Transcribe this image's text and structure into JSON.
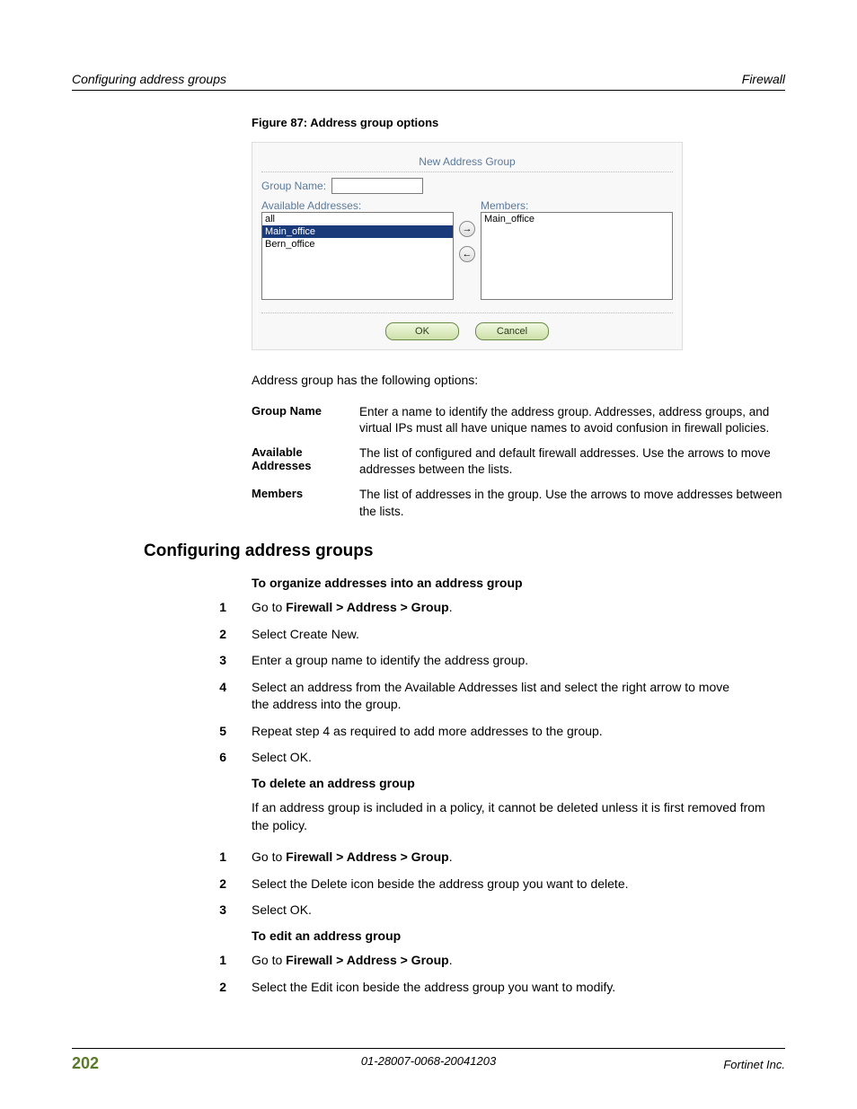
{
  "header": {
    "left": "Configuring address groups",
    "right": "Firewall"
  },
  "figure": {
    "caption": "Figure 87: Address group options",
    "title": "New Address Group",
    "group_name_label": "Group Name:",
    "available_label": "Available Addresses:",
    "members_label": "Members:",
    "available_items": [
      "all",
      "Main_office",
      "Bern_office"
    ],
    "available_selected_index": 1,
    "members_items": [
      "Main_office"
    ],
    "ok_label": "OK",
    "cancel_label": "Cancel"
  },
  "intro": "Address group has the following options:",
  "options": [
    {
      "term": "Group Name",
      "desc": "Enter a name to identify the address group. Addresses, address groups, and virtual IPs must all have unique names to avoid confusion in firewall policies."
    },
    {
      "term": "Available Addresses",
      "desc": "The list of configured and default firewall addresses. Use the arrows to move addresses between the lists."
    },
    {
      "term": "Members",
      "desc": "The list of addresses in the group. Use the arrows to move addresses between the lists."
    }
  ],
  "section_heading": "Configuring address groups",
  "proc1": {
    "heading": "To organize addresses into an address group",
    "steps": [
      {
        "n": "1",
        "pre": "Go to ",
        "bold": "Firewall > Address > Group",
        "post": "."
      },
      {
        "n": "2",
        "text": "Select Create New."
      },
      {
        "n": "3",
        "text": "Enter a group name to identify the address group."
      },
      {
        "n": "4",
        "text": "Select an address from the Available Addresses list and select the right arrow to move the address into the group."
      },
      {
        "n": "5",
        "text": "Repeat step 4 as required to add more addresses to the group."
      },
      {
        "n": "6",
        "text": "Select OK."
      }
    ]
  },
  "proc2": {
    "heading": "To delete an address group",
    "intro": "If an address group is included in a policy, it cannot be deleted unless it is first removed from the policy.",
    "steps": [
      {
        "n": "1",
        "pre": "Go to ",
        "bold": "Firewall > Address > Group",
        "post": "."
      },
      {
        "n": "2",
        "text": "Select the Delete icon beside the address group you want to delete."
      },
      {
        "n": "3",
        "text": "Select OK."
      }
    ]
  },
  "proc3": {
    "heading": "To edit an address group",
    "steps": [
      {
        "n": "1",
        "pre": "Go to ",
        "bold": "Firewall > Address > Group",
        "post": "."
      },
      {
        "n": "2",
        "text": "Select the Edit icon beside the address group you want to modify."
      }
    ]
  },
  "footer": {
    "page": "202",
    "center": "01-28007-0068-20041203",
    "right": "Fortinet Inc."
  }
}
